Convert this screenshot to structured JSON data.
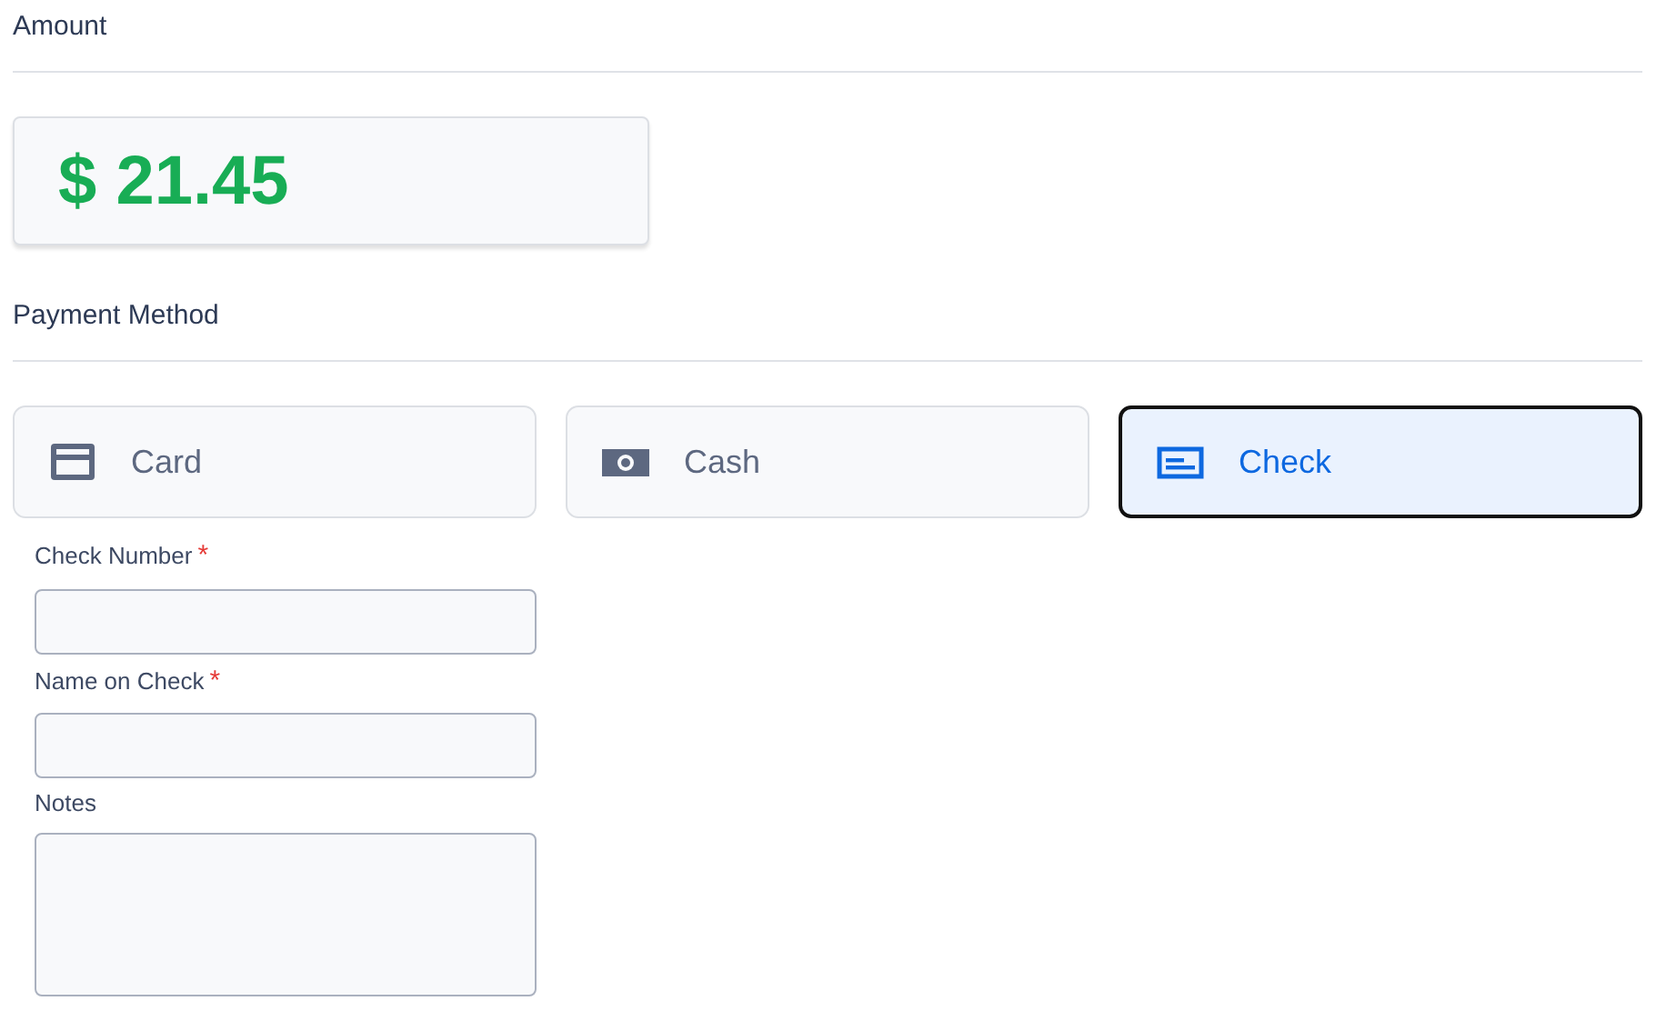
{
  "amount": {
    "heading": "Amount",
    "value": "$ 21.45"
  },
  "payment_method": {
    "heading": "Payment Method",
    "options": [
      {
        "label": "Card",
        "kind": "card",
        "selected": false
      },
      {
        "label": "Cash",
        "kind": "cash",
        "selected": false
      },
      {
        "label": "Check",
        "kind": "check",
        "selected": true
      }
    ]
  },
  "fields": [
    {
      "label": "Check Number",
      "required_mark": "*",
      "kind": "input"
    },
    {
      "label": "Name on Check",
      "required_mark": "*",
      "kind": "input"
    },
    {
      "label": "Notes",
      "kind": "textarea"
    }
  ]
}
